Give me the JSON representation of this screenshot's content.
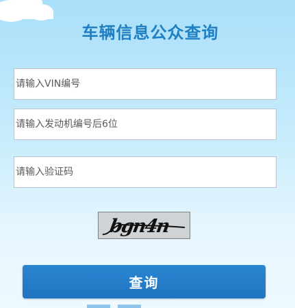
{
  "page": {
    "title": "车辆信息公众查询"
  },
  "form": {
    "vin_placeholder": "请输入VIN编号",
    "engine_placeholder": "请输入发动机编号后6位",
    "captcha_placeholder": "请输入验证码",
    "captcha_text": "bgn4n",
    "submit_label": "查询"
  },
  "colors": {
    "title": "#1f7fc2",
    "button": "#2178c6",
    "background_top": "#a9dff9",
    "background_bottom": "#eef9ff"
  },
  "icons": {
    "corner_decoration": "cloud-icon"
  }
}
